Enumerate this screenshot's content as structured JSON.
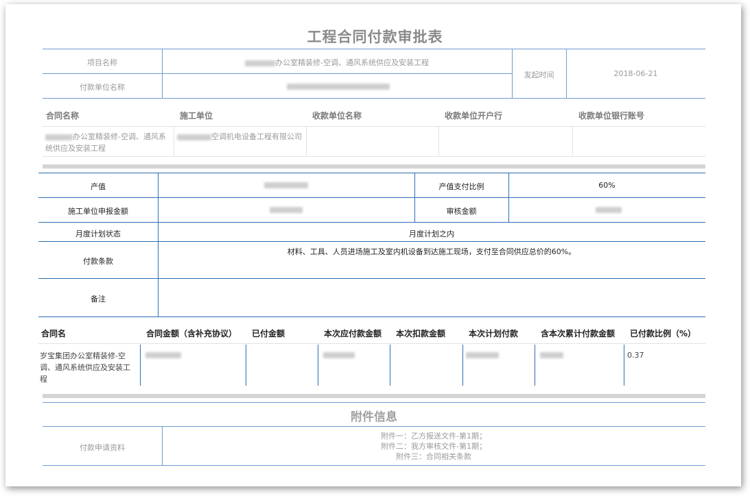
{
  "title": "工程合同付款审批表",
  "basic_info": {
    "project_name_label": "项目名称",
    "project_name_value": "办公室精装修-空调、通风系统供应及安装工程",
    "payer_label": "付款单位名称",
    "start_time_label": "发起时间",
    "start_time_value": "2018-06-21"
  },
  "contract_table": {
    "headers": [
      "合同名称",
      "施工单位",
      "收款单位名称",
      "收款单位开户行",
      "收款单位银行账号"
    ],
    "contract_name": "办公室精装修-空调、通风系统供应及安装工程",
    "contractor": "空调机电设备工程有限公司"
  },
  "payment": {
    "output_label": "产值",
    "ratio_label": "产值支付比例",
    "ratio_value": "60%",
    "declared_label": "施工单位申报金额",
    "audit_label": "审核金额",
    "monthly_label": "月度计划状态",
    "monthly_value": "月度计划之内",
    "terms_label": "付款条款",
    "terms_value": "材料、工具、人员进场施工及室内机设备到达施工现场，支付至合同供应总价的60%。",
    "remark_label": "备注"
  },
  "summary_table": {
    "headers": [
      "合同名",
      "合同金额（含补充协议）",
      "已付金额",
      "本次应付款金额",
      "本次扣款金额",
      "本次计划付款",
      "含本次累计付款金额",
      "已付款比例（%）"
    ],
    "contract_name": "岁宝集团办公室精装修-空调、通风系统供应及安装工程",
    "paid_ratio": "0.37"
  },
  "attachments": {
    "title": "附件信息",
    "label": "付款申请资料",
    "items": [
      "附件一：乙方报送文件-第1期；",
      "附件二：我方审核文件-第1期；",
      "附件三：合同相关条款"
    ]
  }
}
